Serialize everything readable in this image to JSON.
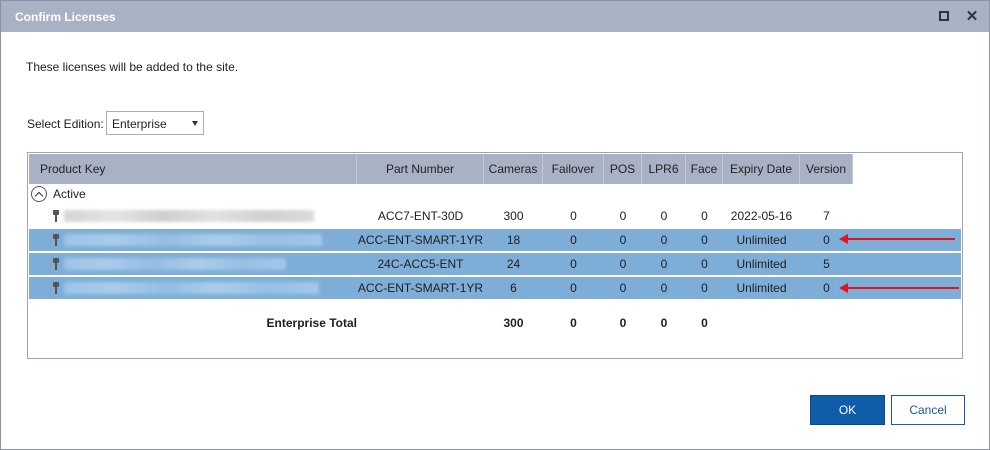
{
  "window": {
    "title": "Confirm Licenses",
    "maximize_icon": "maximize-icon",
    "close_icon": "close-icon",
    "close_glyph": "✕"
  },
  "description": "These licenses will be added to the site.",
  "edition": {
    "label": "Select Edition:",
    "value": "Enterprise"
  },
  "grid": {
    "columns": [
      "Product Key",
      "Part Number",
      "Cameras",
      "Failover",
      "POS",
      "LPR6",
      "Face",
      "Expiry Date",
      "Version"
    ],
    "group_label": "Active",
    "rows": [
      {
        "part": "ACC7-ENT-30D",
        "cameras": "300",
        "failover": "0",
        "pos": "0",
        "lpr6": "0",
        "face": "0",
        "expiry": "2022-05-16",
        "version": "7",
        "selected": false
      },
      {
        "part": "ACC-ENT-SMART-1YR",
        "cameras": "18",
        "failover": "0",
        "pos": "0",
        "lpr6": "0",
        "face": "0",
        "expiry": "Unlimited",
        "version": "0",
        "selected": true
      },
      {
        "part": "24C-ACC5-ENT",
        "cameras": "24",
        "failover": "0",
        "pos": "0",
        "lpr6": "0",
        "face": "0",
        "expiry": "Unlimited",
        "version": "5",
        "selected": true
      },
      {
        "part": "ACC-ENT-SMART-1YR",
        "cameras": "6",
        "failover": "0",
        "pos": "0",
        "lpr6": "0",
        "face": "0",
        "expiry": "Unlimited",
        "version": "0",
        "selected": true
      }
    ],
    "total": {
      "label": "Enterprise Total",
      "cameras": "300",
      "failover": "0",
      "pos": "0",
      "lpr6": "0",
      "face": "0"
    }
  },
  "buttons": {
    "ok": "OK",
    "cancel": "Cancel"
  },
  "colors": {
    "titlebar": "#a9b1c4",
    "selected_row": "#7eaed8",
    "ok_button": "#0f5ca8",
    "annotation_arrow": "#e0141e"
  }
}
